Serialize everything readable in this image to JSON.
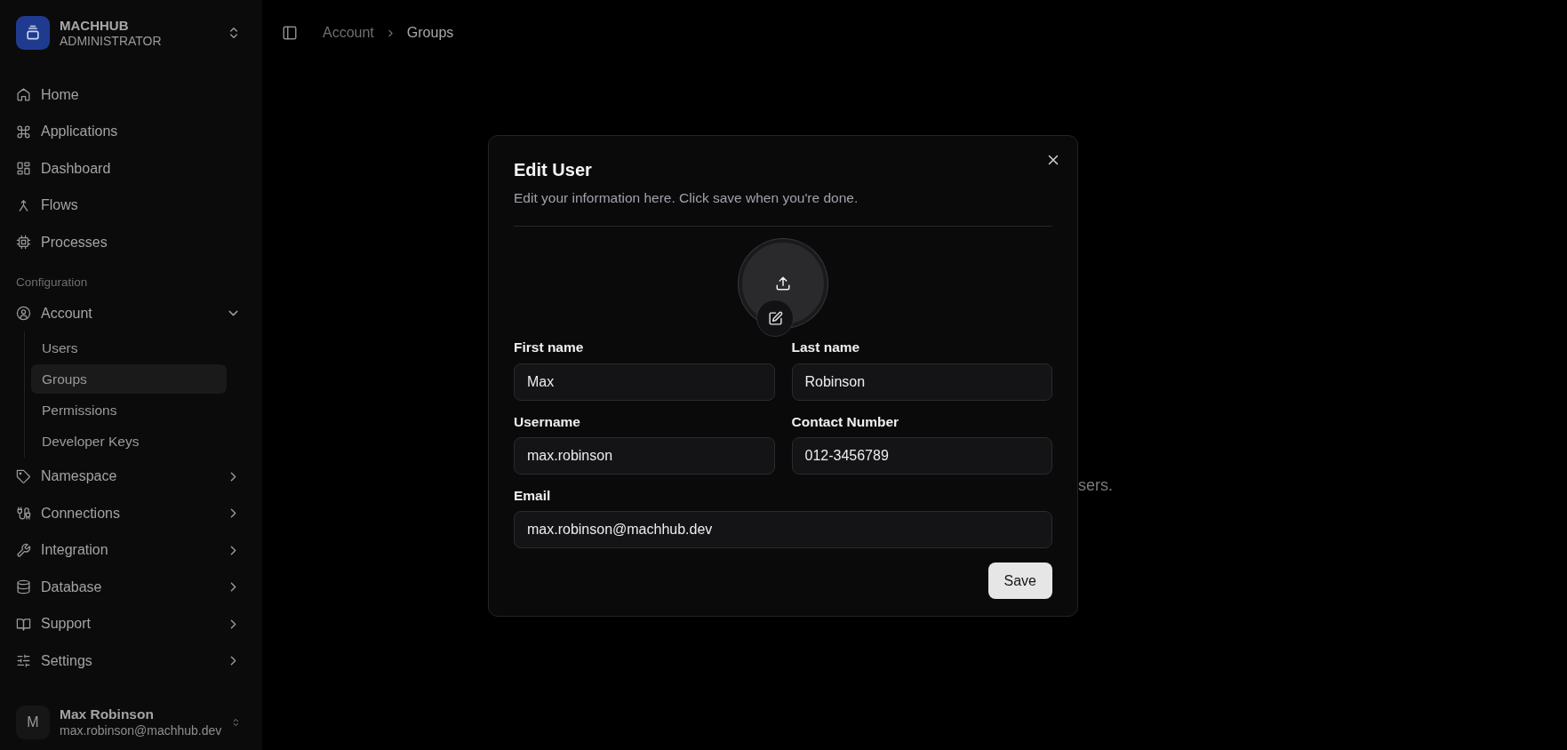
{
  "sidebar": {
    "brand": {
      "name": "MACHHUB",
      "role": "ADMINISTRATOR"
    },
    "items": [
      {
        "label": "Home"
      },
      {
        "label": "Applications"
      },
      {
        "label": "Dashboard"
      },
      {
        "label": "Flows"
      },
      {
        "label": "Processes"
      }
    ],
    "configuration": {
      "title": "Configuration",
      "items": [
        {
          "label": "Account",
          "expanded": true,
          "children": [
            {
              "label": "Users",
              "selected": false
            },
            {
              "label": "Groups",
              "selected": true
            },
            {
              "label": "Permissions",
              "selected": false
            },
            {
              "label": "Developer Keys",
              "selected": false
            }
          ]
        },
        {
          "label": "Namespace",
          "expanded": false
        },
        {
          "label": "Connections",
          "expanded": false
        },
        {
          "label": "Integration",
          "expanded": false
        },
        {
          "label": "Database",
          "expanded": false
        },
        {
          "label": "Support",
          "expanded": false
        },
        {
          "label": "Settings",
          "expanded": false
        }
      ]
    },
    "user": {
      "initial": "M",
      "name": "Max Robinson",
      "email": "max.robinson@machhub.dev"
    }
  },
  "header": {
    "breadcrumb": [
      "Account",
      "Groups"
    ]
  },
  "background_text": "sers.",
  "dialog": {
    "title": "Edit User",
    "description": "Edit your information here. Click save when you're done.",
    "rows": [
      [
        {
          "label": "First name",
          "value": "Max"
        },
        {
          "label": "Last name",
          "value": "Robinson"
        }
      ],
      [
        {
          "label": "Username",
          "value": "max.robinson"
        },
        {
          "label": "Contact Number",
          "value": "012-3456789"
        }
      ],
      [
        {
          "label": "Email",
          "value": "max.robinson@machhub.dev"
        }
      ]
    ],
    "button": "Save"
  }
}
